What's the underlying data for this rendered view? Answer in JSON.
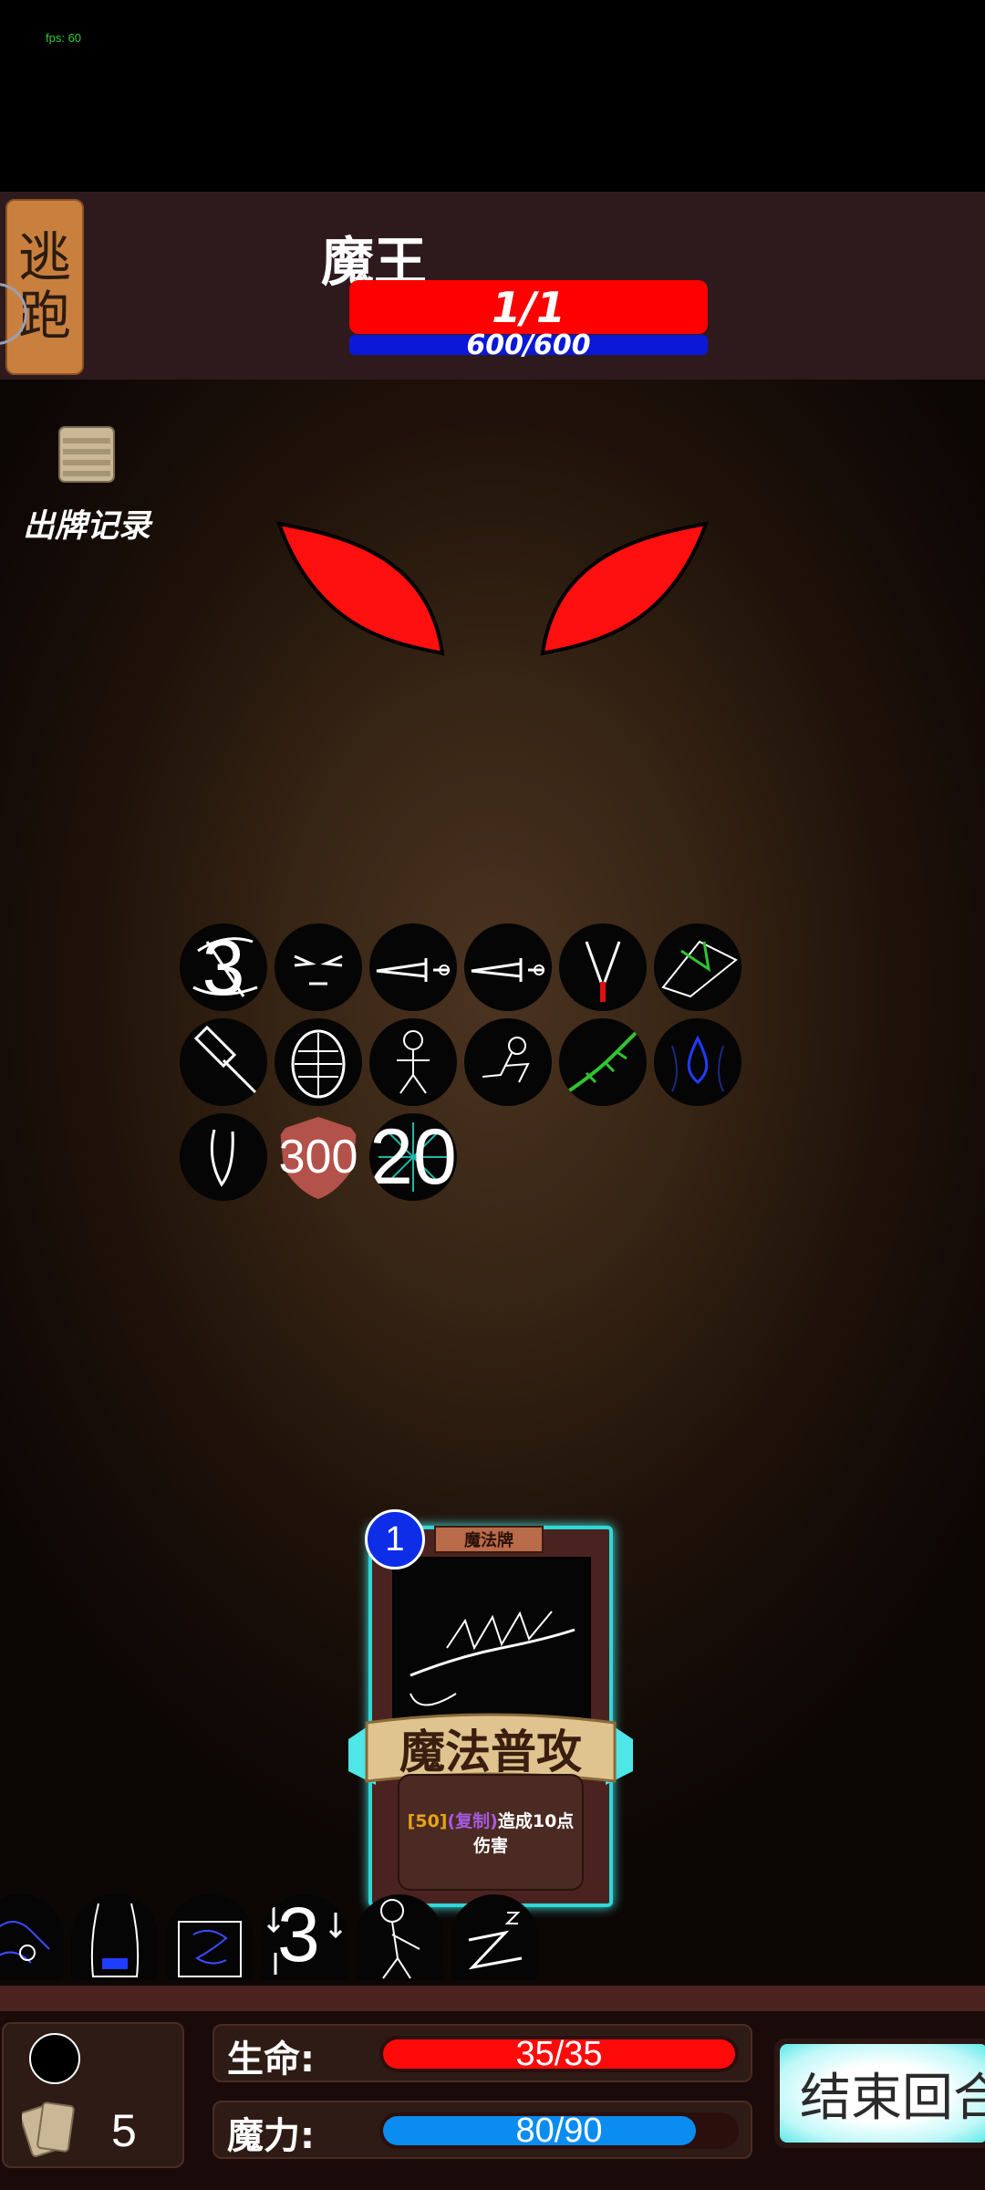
{
  "fps_text": "fps: 60",
  "topbar": {
    "flee_char_1": "逃",
    "flee_char_2": "跑",
    "boss_name": "魔王",
    "boss_hp_text": "1/1",
    "boss_mana_text": "600/600",
    "colors": {
      "hp": "#ff0000",
      "mana": "#0b18d8"
    }
  },
  "history": {
    "label": "出牌记录",
    "icon": "card-stack-icon"
  },
  "boss": {
    "visual": "red-eyes"
  },
  "statuses": [
    {
      "icon": "slash-icon",
      "number": "3"
    },
    {
      "icon": "angry-face-icon"
    },
    {
      "icon": "sword-icon"
    },
    {
      "icon": "sword-icon"
    },
    {
      "icon": "fang-icon"
    },
    {
      "icon": "green-shard-icon"
    },
    {
      "icon": "hammer-icon"
    },
    {
      "icon": "armor-icon"
    },
    {
      "icon": "stick-figure-icon"
    },
    {
      "icon": "kneeling-figure-icon"
    },
    {
      "icon": "green-vine-icon"
    },
    {
      "icon": "blue-drop-icon"
    },
    {
      "icon": "claw-icon"
    },
    {
      "icon": "shield-icon",
      "number": "300"
    },
    {
      "icon": "burst-icon",
      "number": "20"
    }
  ],
  "card": {
    "cost": "1",
    "type": "魔法牌",
    "name": "魔法普攻",
    "desc_number": "[50]",
    "desc_tag": "(复制)",
    "desc_text": "造成10点伤害"
  },
  "hand": [
    {
      "icon": "blue-scribble-icon"
    },
    {
      "icon": "blue-robe-icon"
    },
    {
      "icon": "blue-web-icon"
    },
    {
      "icon": "blue-number-icon",
      "number": "3"
    },
    {
      "icon": "stickman-icon"
    },
    {
      "icon": "zigzag-icon"
    }
  ],
  "player": {
    "deck_count": "5",
    "hp_label": "生命:",
    "hp_text": "35/35",
    "hp_fraction": 1.0,
    "mana_label": "魔力:",
    "mana_text": "80/90",
    "mana_fraction": 0.889,
    "colors": {
      "hp": "#ff0a0a",
      "mana": "#0a8cf0"
    }
  },
  "end_turn_label": "结束回合"
}
